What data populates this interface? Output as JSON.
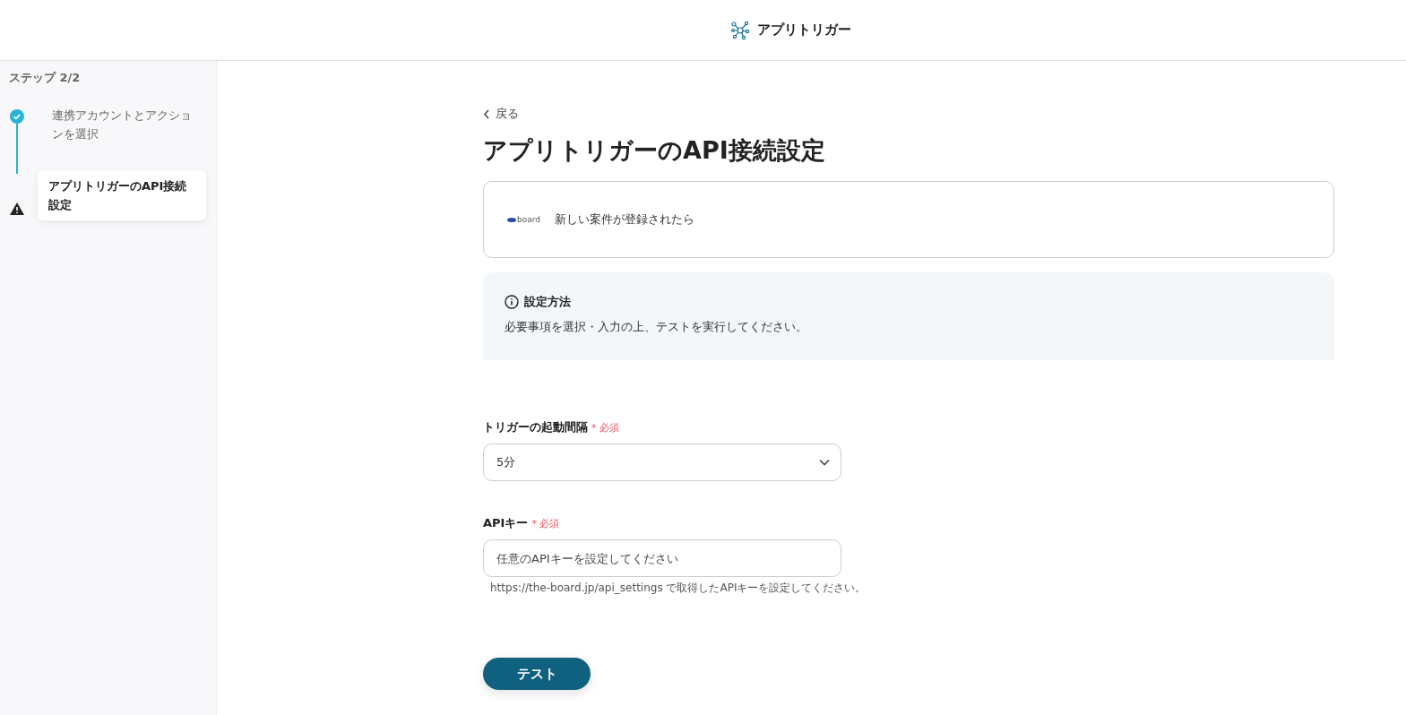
{
  "header": {
    "title": "アプリトリガー"
  },
  "sidebar": {
    "step_label": "ステップ 2/2",
    "steps": [
      {
        "label": "連携アカウントとアクションを選択",
        "kind": "done",
        "selected": false
      },
      {
        "label": "アプリトリガーのAPI接続設定",
        "kind": "warning",
        "selected": true
      }
    ]
  },
  "main": {
    "back": "戻る",
    "title": "アプリトリガーのAPI接続設定",
    "trigger_card": {
      "logo_text": "board",
      "text": "新しい案件が登録されたら"
    },
    "info": {
      "title": "設定方法",
      "text": "必要事項を選択・入力の上、テストを実行してください。"
    },
    "fields": [
      {
        "kind": "select",
        "label": "トリガーの起動間隔",
        "required": "* 必須",
        "value": "5分"
      },
      {
        "kind": "text",
        "label": "APIキー",
        "required": "* 必須",
        "placeholder": "任意のAPIキーを設定してください",
        "help": "https://the-board.jp/api_settings で取得したAPIキーを設定してください。"
      }
    ],
    "button": "テスト"
  }
}
